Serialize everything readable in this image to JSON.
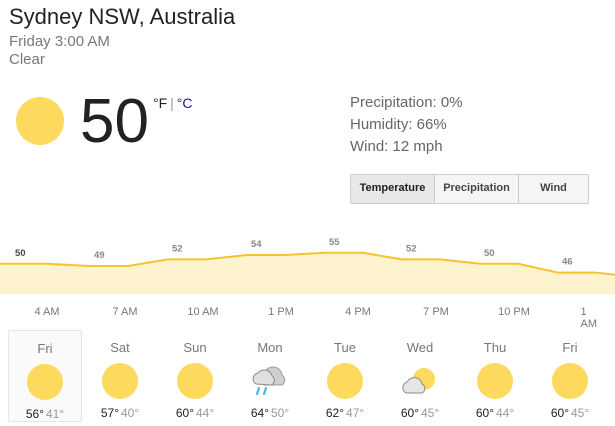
{
  "location": "Sydney NSW, Australia",
  "datetime": "Friday 3:00 AM",
  "condition": "Clear",
  "current": {
    "temp": "50",
    "unit_f": "°F",
    "unit_sep": "|",
    "unit_c": "°C",
    "icon": "sun-icon"
  },
  "details": {
    "precipitation": "Precipitation: 0%",
    "humidity": "Humidity: 66%",
    "wind": "Wind: 12 mph"
  },
  "tabs": [
    {
      "label": "Temperature",
      "active": true
    },
    {
      "label": "Precipitation",
      "active": false
    },
    {
      "label": "Wind",
      "active": false
    }
  ],
  "chart_data": {
    "type": "area",
    "labels": [
      "50",
      "49",
      "52",
      "54",
      "55",
      "52",
      "50",
      "46"
    ],
    "values": [
      50,
      49,
      52,
      54,
      55,
      52,
      50,
      46
    ],
    "color_line": "#f4c430",
    "color_fill": "#fdf3cf"
  },
  "times": [
    "4 AM",
    "7 AM",
    "10 AM",
    "1 PM",
    "4 PM",
    "7 PM",
    "10 PM",
    "1 AM"
  ],
  "forecast": [
    {
      "day": "Fri",
      "icon": "sun-icon",
      "hi": "56°",
      "lo": "41°",
      "selected": true
    },
    {
      "day": "Sat",
      "icon": "sun-icon",
      "hi": "57°",
      "lo": "40°",
      "selected": false
    },
    {
      "day": "Sun",
      "icon": "sun-icon",
      "hi": "60°",
      "lo": "44°",
      "selected": false
    },
    {
      "day": "Mon",
      "icon": "rain-cloud-icon",
      "hi": "64°",
      "lo": "50°",
      "selected": false
    },
    {
      "day": "Tue",
      "icon": "sun-icon",
      "hi": "62°",
      "lo": "47°",
      "selected": false
    },
    {
      "day": "Wed",
      "icon": "partly-cloudy-icon",
      "hi": "60°",
      "lo": "45°",
      "selected": false
    },
    {
      "day": "Thu",
      "icon": "sun-icon",
      "hi": "60°",
      "lo": "44°",
      "selected": false
    },
    {
      "day": "Fri",
      "icon": "sun-icon",
      "hi": "60°",
      "lo": "45°",
      "selected": false
    }
  ]
}
